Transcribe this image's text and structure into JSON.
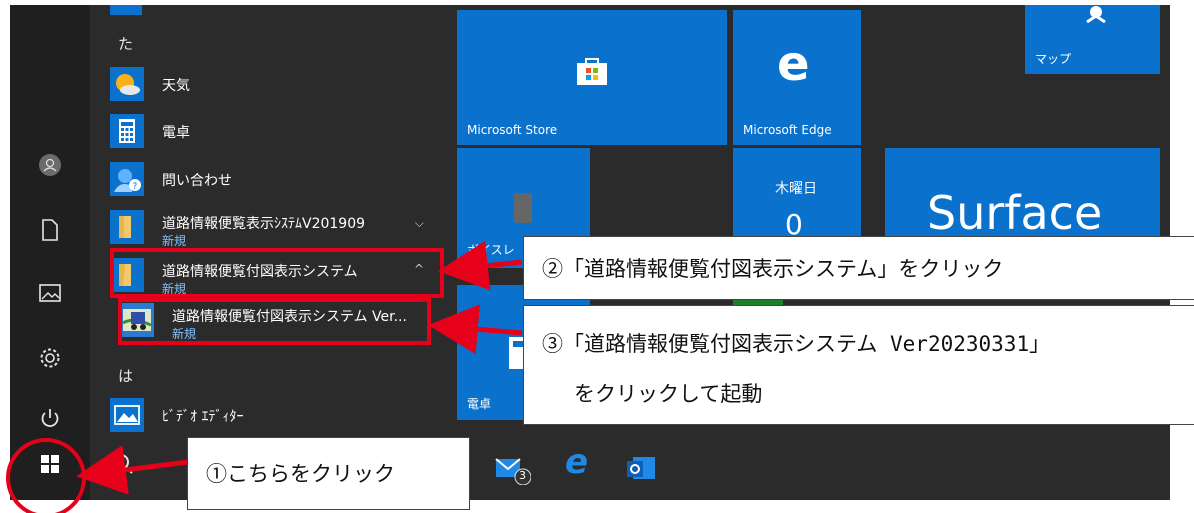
{
  "letters": {
    "ta": "た",
    "ha": "は"
  },
  "apps": [
    {
      "name": "天気",
      "icon": "weather-icon"
    },
    {
      "name": "電卓",
      "icon": "calculator-icon"
    },
    {
      "name": "問い合わせ",
      "icon": "contact-support-icon"
    },
    {
      "name": "道路情報便覧表示ｼｽﾃﾑV201909",
      "sub": "新規",
      "icon": "folder-icon"
    },
    {
      "name": "道路情報便覧付図表示システム",
      "sub": "新規",
      "icon": "folder-icon"
    },
    {
      "name": "道路情報便覧付図表示システム Ver...",
      "sub": "新規",
      "icon": "truck-map-icon"
    },
    {
      "name": "ﾋﾞﾃﾞｵ ｴﾃﾞｨﾀｰ",
      "icon": "video-editor-icon"
    }
  ],
  "tiles": {
    "store": "Microsoft Store",
    "edge": "Microsoft Edge",
    "maps": "マップ",
    "calendar_day": "木曜日",
    "surface": "Surface",
    "partial_label": "ボイスレ",
    "calc": "電卓"
  },
  "taskbar": {
    "mail_badge": "3"
  },
  "callouts": {
    "c1": "①こちらをクリック",
    "c2": "②「道路情報便覧付図表示システム」をクリック",
    "c3_line1": "③「道路情報便覧付図表示システム Ver20230331」",
    "c3_line2": "をクリックして起動"
  },
  "colors": {
    "tile_blue": "#0a72cc",
    "highlight_red": "#e6001a",
    "menu_bg": "#2b2b2b"
  }
}
